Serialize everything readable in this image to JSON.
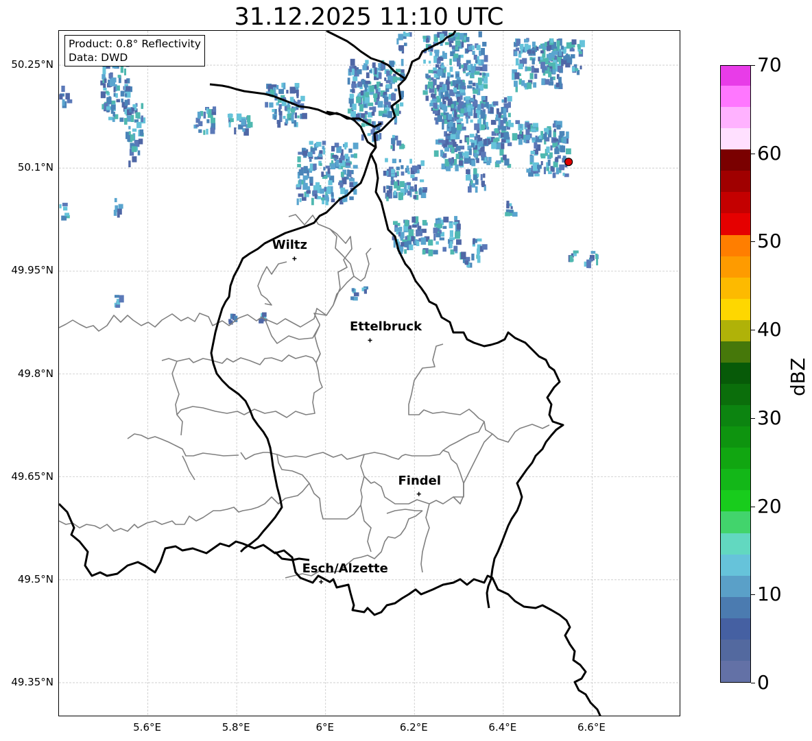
{
  "title": "31.12.2025 11:10 UTC",
  "info_box": {
    "line1": "Product: 0.8° Reflectivity",
    "line2": "Data: DWD"
  },
  "axes": {
    "lat_labels": [
      "50.25°N",
      "50.1°N",
      "49.95°N",
      "49.8°N",
      "49.65°N",
      "49.5°N",
      "49.35°N"
    ],
    "lon_labels": [
      "5.6°E",
      "5.8°E",
      "6°E",
      "6.2°E",
      "6.4°E",
      "6.6°E"
    ],
    "lat_values": [
      50.25,
      50.1,
      49.95,
      49.8,
      49.65,
      49.5,
      49.35
    ],
    "lon_values": [
      5.6,
      5.8,
      6.0,
      6.2,
      6.4,
      6.6
    ],
    "lon_range": [
      5.4,
      6.8
    ],
    "lat_range": [
      49.3,
      50.3
    ],
    "grid": true
  },
  "cities": [
    {
      "name": "Wiltz",
      "lon": 5.93,
      "lat": 49.968
    },
    {
      "name": "Ettelbruck",
      "lon": 6.1,
      "lat": 49.849
    },
    {
      "name": "Findel",
      "lon": 6.21,
      "lat": 49.625
    },
    {
      "name": "Esch/Alzette",
      "lon": 5.99,
      "lat": 49.497
    }
  ],
  "radar_site": {
    "lon": 6.547,
    "lat": 50.109,
    "color": "#e00000"
  },
  "colorbar": {
    "unit": "dBZ",
    "min": 0,
    "max": 70,
    "tick_labels": [
      "0",
      "10",
      "20",
      "30",
      "40",
      "50",
      "60",
      "70"
    ],
    "colors": [
      "#6371a6",
      "#53699f",
      "#4560a2",
      "#4b7bb0",
      "#5aa0c8",
      "#66c3da",
      "#62d8c0",
      "#42d46c",
      "#18cc1c",
      "#13b718",
      "#11a611",
      "#0e940f",
      "#0c8410",
      "#0b6e0b",
      "#075a08",
      "#46780a",
      "#b0b208",
      "#fed700",
      "#fdba00",
      "#fe9b00",
      "#ff7e00",
      "#e50000",
      "#c40000",
      "#a00000",
      "#7a0000",
      "#ffe0ff",
      "#ffb2ff",
      "#ff77ff",
      "#e83ce8"
    ]
  }
}
